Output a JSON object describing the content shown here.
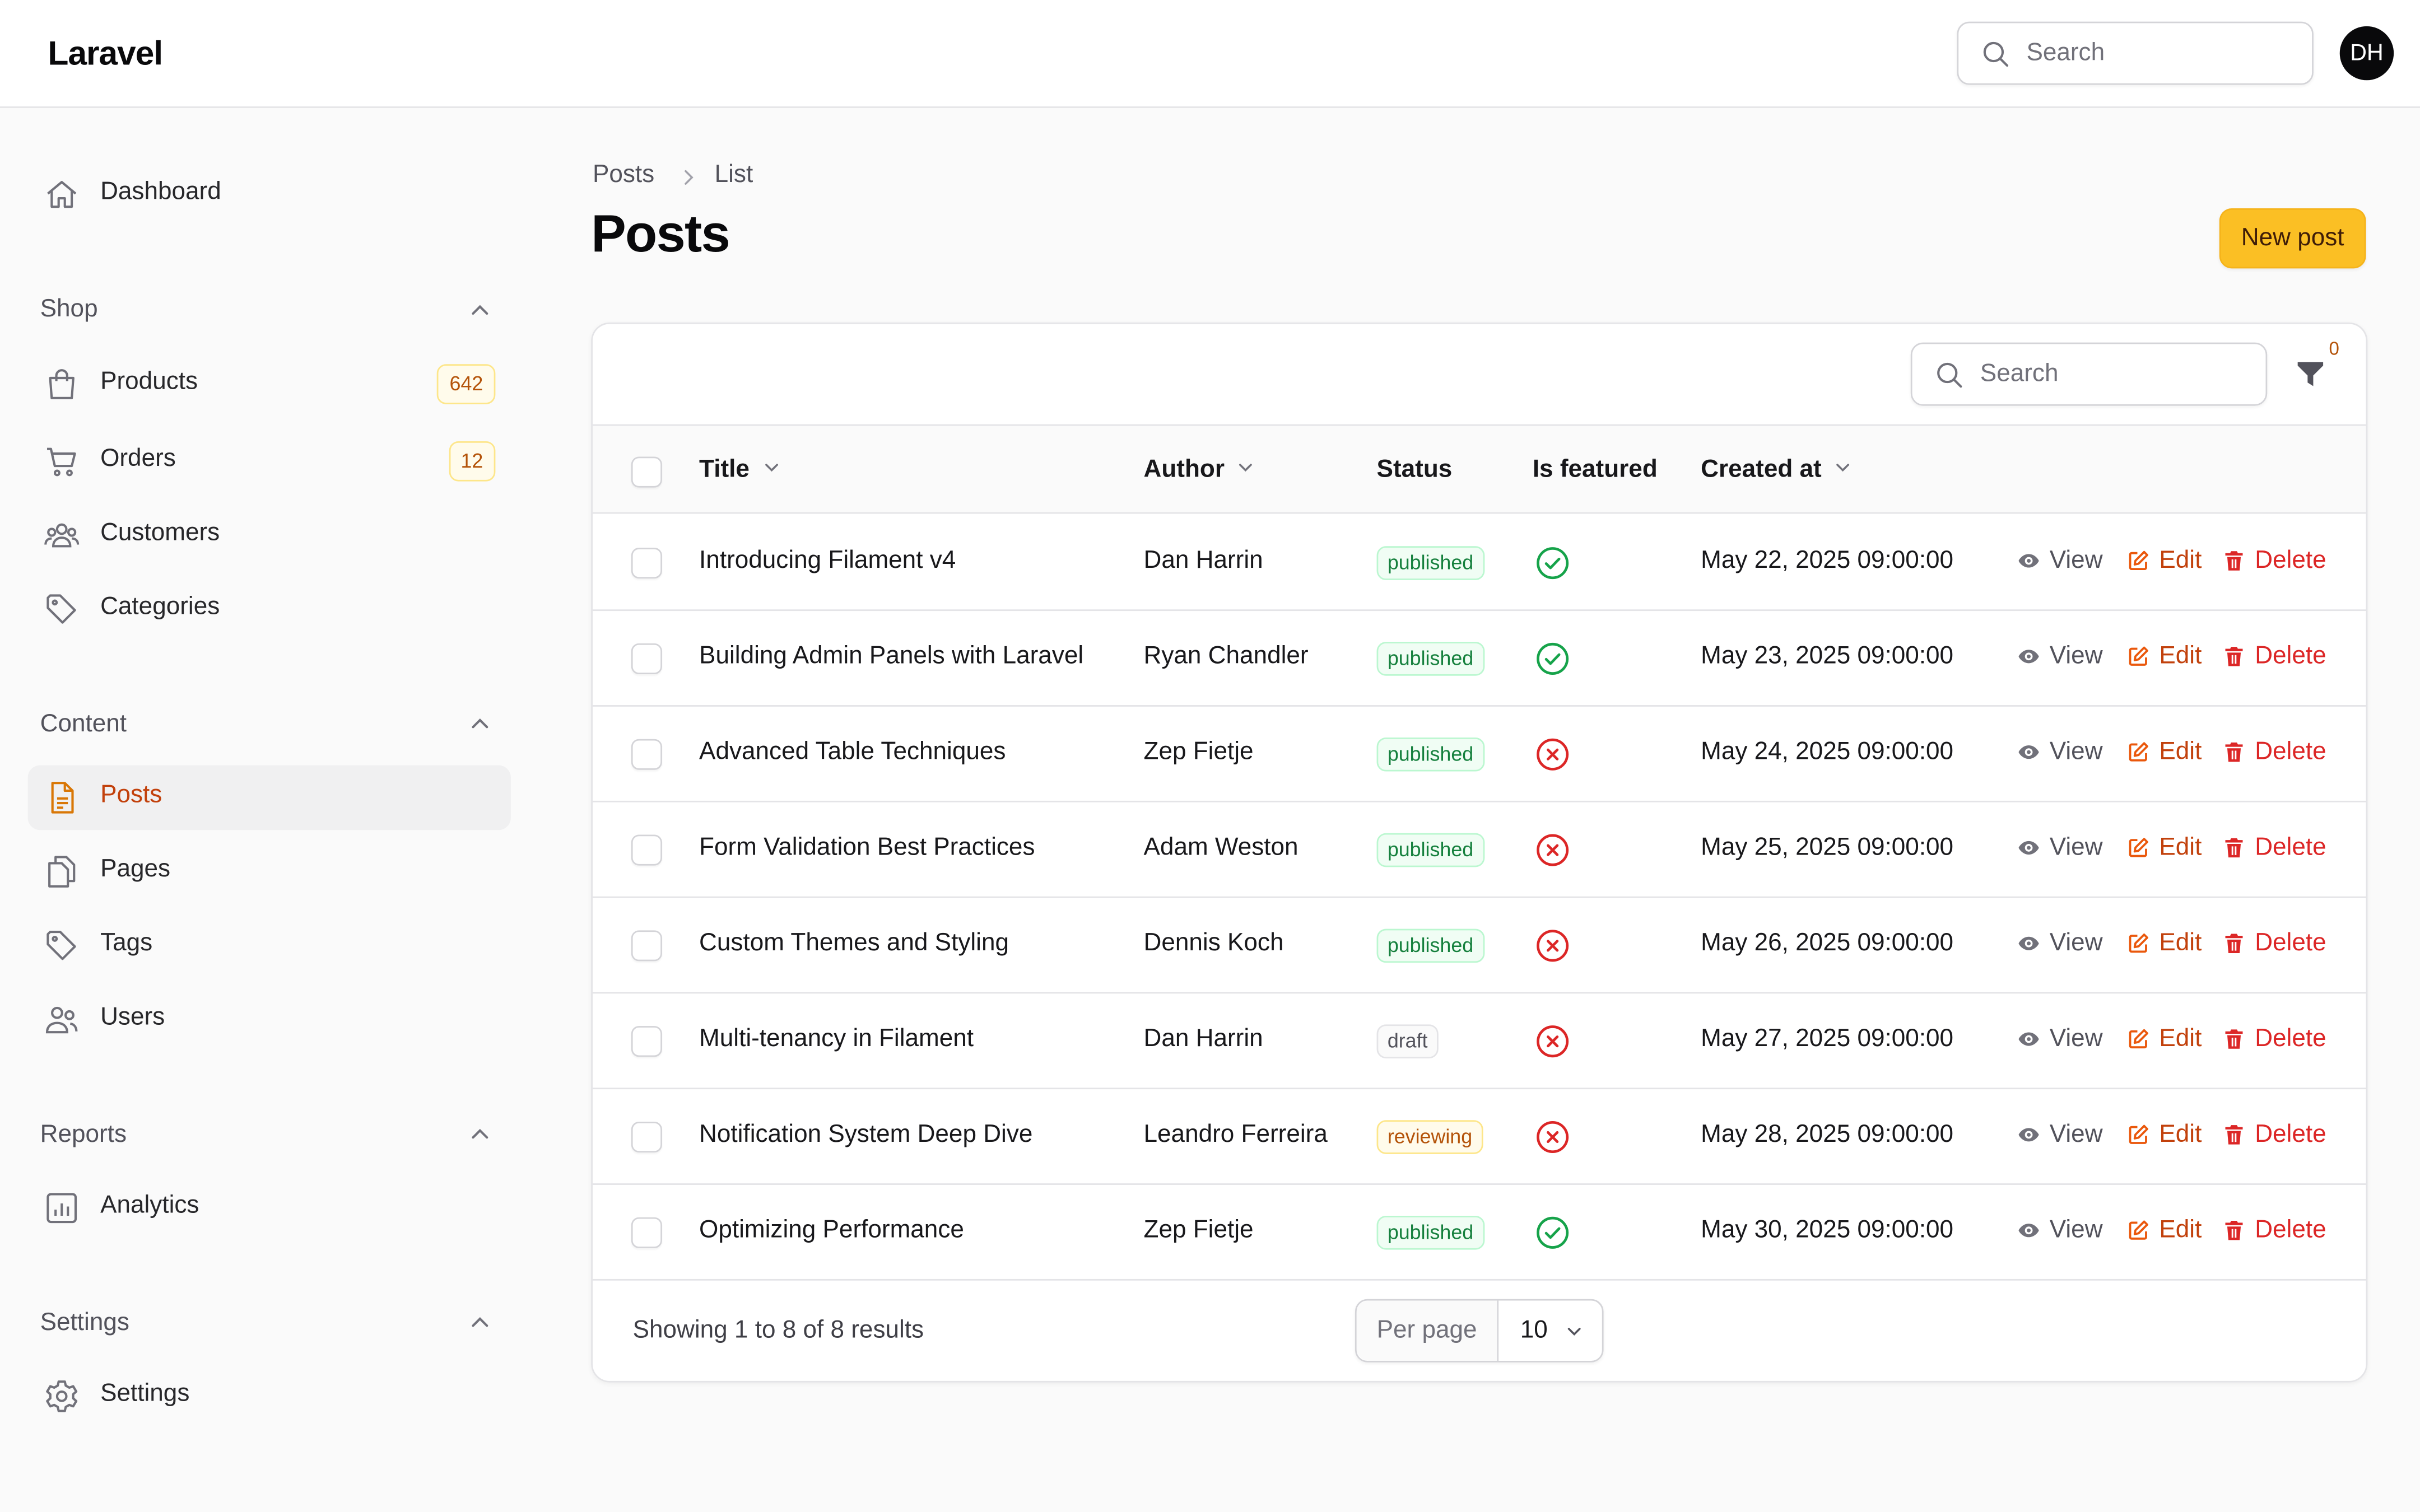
{
  "app": {
    "brand": "Laravel",
    "avatar_initials": "DH"
  },
  "top_search": {
    "placeholder": "Search"
  },
  "sidebar": {
    "dashboard": "Dashboard",
    "groups": {
      "shop": {
        "title": "Shop",
        "products": "Products",
        "products_count": "642",
        "orders": "Orders",
        "orders_count": "12",
        "customers": "Customers",
        "categories": "Categories"
      },
      "content": {
        "title": "Content",
        "posts": "Posts",
        "pages": "Pages",
        "tags": "Tags",
        "users": "Users"
      },
      "reports": {
        "title": "Reports",
        "analytics": "Analytics"
      },
      "settings": {
        "title": "Settings",
        "settings": "Settings"
      }
    },
    "active_item": "Posts"
  },
  "breadcrumb": {
    "parent": "Posts",
    "current": "List"
  },
  "page": {
    "title": "Posts",
    "new_button": "New post"
  },
  "table": {
    "search_placeholder": "Search",
    "filter_count": "0",
    "columns": {
      "title": "Title",
      "author": "Author",
      "status": "Status",
      "featured": "Is featured",
      "created": "Created at"
    },
    "actions": {
      "view": "View",
      "edit": "Edit",
      "delete": "Delete"
    },
    "rows": [
      {
        "title": "Introducing Filament v4",
        "author": "Dan Harrin",
        "status": "published",
        "featured": true,
        "created": "May 22, 2025 09:00:00"
      },
      {
        "title": "Building Admin Panels with Laravel",
        "author": "Ryan Chandler",
        "status": "published",
        "featured": true,
        "created": "May 23, 2025 09:00:00"
      },
      {
        "title": "Advanced Table Techniques",
        "author": "Zep Fietje",
        "status": "published",
        "featured": false,
        "created": "May 24, 2025 09:00:00"
      },
      {
        "title": "Form Validation Best Practices",
        "author": "Adam Weston",
        "status": "published",
        "featured": false,
        "created": "May 25, 2025 09:00:00"
      },
      {
        "title": "Custom Themes and Styling",
        "author": "Dennis Koch",
        "status": "published",
        "featured": false,
        "created": "May 26, 2025 09:00:00"
      },
      {
        "title": "Multi-tenancy in Filament",
        "author": "Dan Harrin",
        "status": "draft",
        "featured": false,
        "created": "May 27, 2025 09:00:00"
      },
      {
        "title": "Notification System Deep Dive",
        "author": "Leandro Ferreira",
        "status": "reviewing",
        "featured": false,
        "created": "May 28, 2025 09:00:00"
      },
      {
        "title": "Optimizing Performance",
        "author": "Zep Fietje",
        "status": "published",
        "featured": true,
        "created": "May 30, 2025 09:00:00"
      }
    ],
    "footer": {
      "summary": "Showing 1 to 8 of 8 results",
      "per_page_label": "Per page",
      "per_page_value": "10"
    }
  },
  "colors": {
    "primary": "#fbbf24",
    "accent_text": "#c2410c",
    "success": "#16a34a",
    "danger": "#dc2626"
  },
  "icons": {
    "dashboard": "home-icon",
    "products": "shopping-bag-icon",
    "orders": "shopping-cart-icon",
    "customers": "user-group-icon",
    "categories": "tag-icon",
    "posts": "document-text-icon",
    "pages": "document-duplicate-icon",
    "tags": "tag-icon",
    "users": "users-icon",
    "analytics": "chart-bar-icon",
    "settings": "cog-icon",
    "featured_true": "check-circle-icon",
    "featured_false": "x-circle-icon"
  }
}
